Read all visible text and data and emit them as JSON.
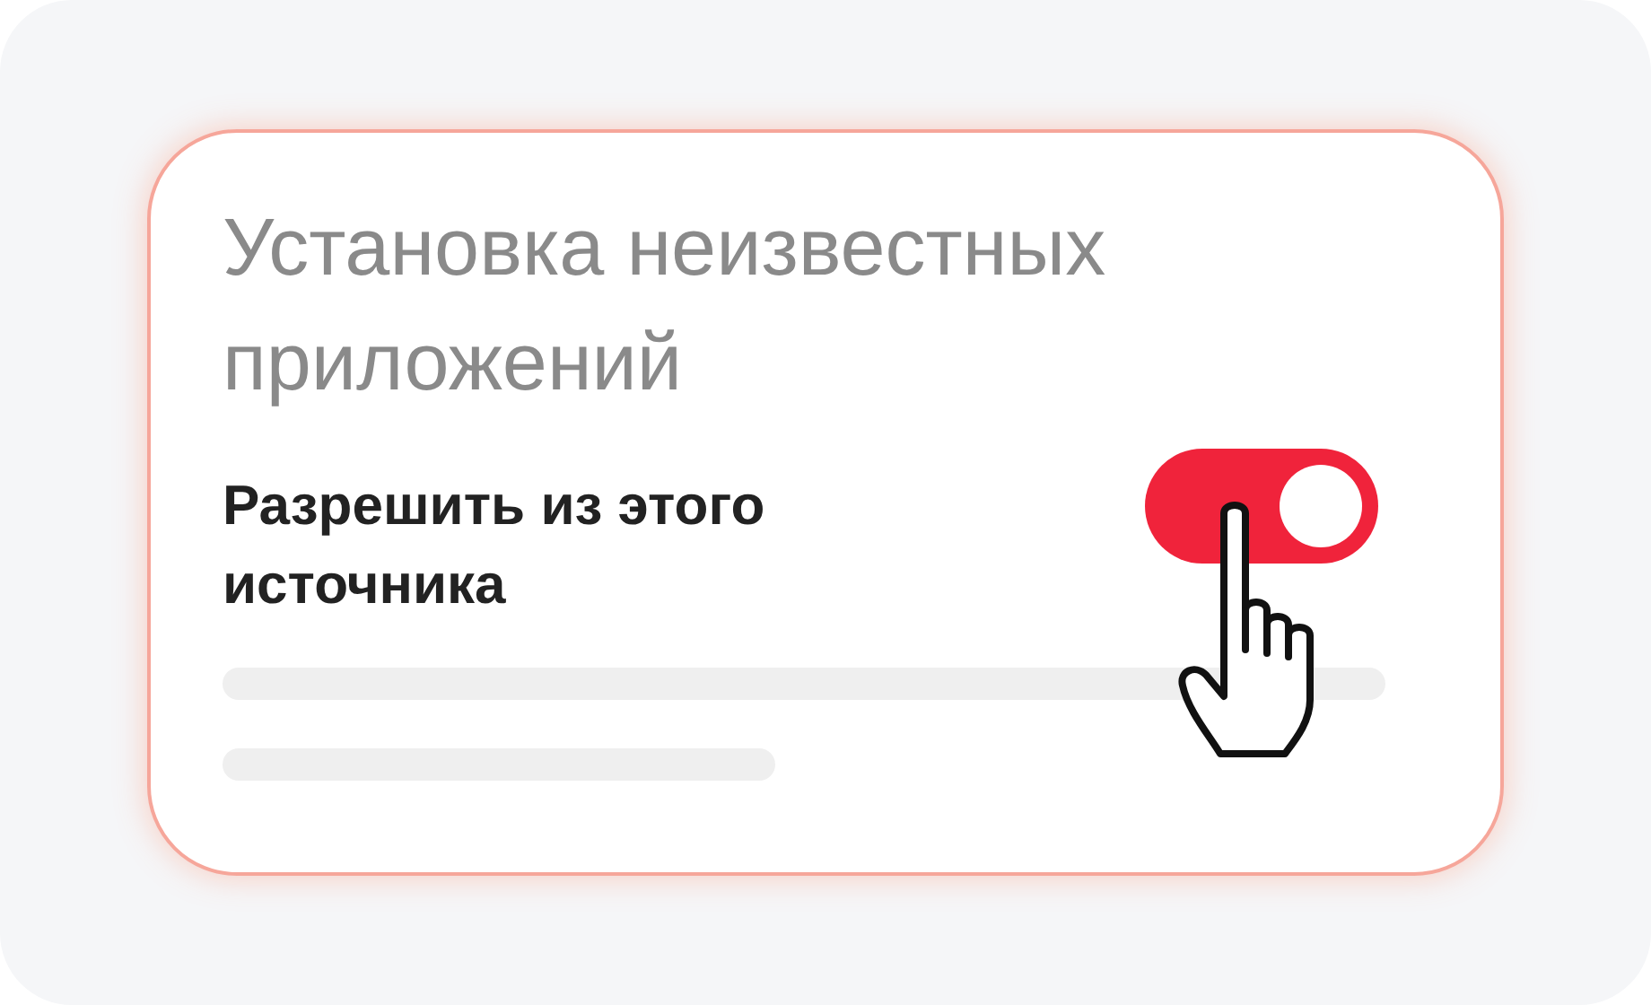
{
  "card": {
    "title": "Установка неизвестных приложений",
    "setting": {
      "label": "Разрешить из этого источника",
      "on": true
    }
  }
}
